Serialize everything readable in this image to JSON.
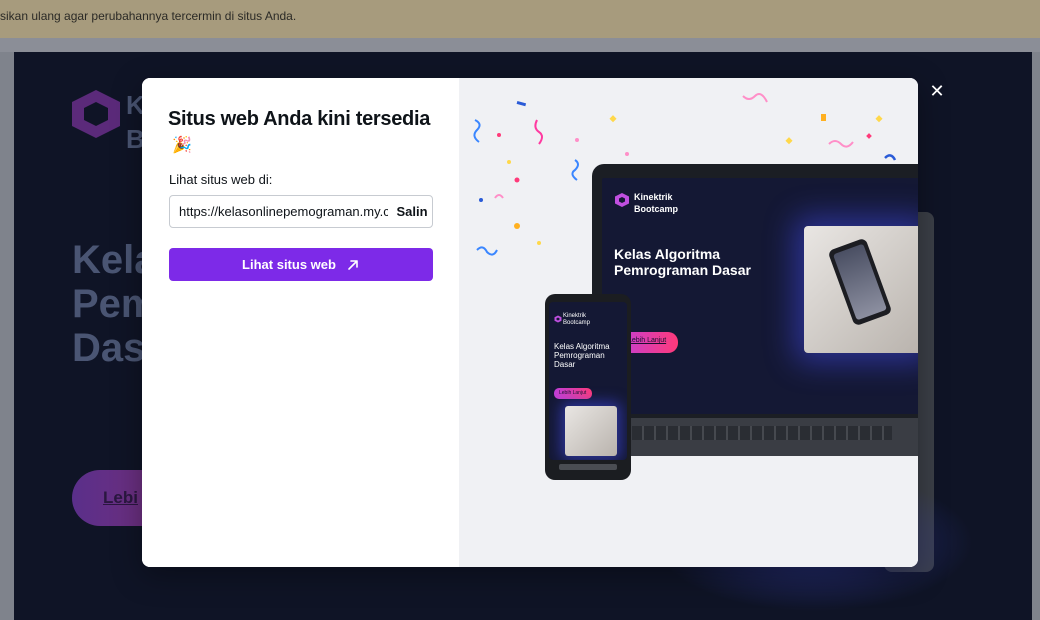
{
  "banner": {
    "text": "sikan ulang agar perubahannya tercermin di situs Anda."
  },
  "background_site": {
    "brand": "K\nB",
    "heading": "Kela\nPem\nDas",
    "cta_label": "Lebi"
  },
  "modal": {
    "title": "Situs web Anda kini tersedia",
    "title_icon": "party-popper-icon",
    "url_label": "Lihat situs web di:",
    "url_value": "https://kelasonlinepemograman.my.canva.site",
    "copy_label": "Salin",
    "view_button_label": "Lihat situs web",
    "view_button_icon": "arrow-up-right-icon",
    "close_icon": "close-icon",
    "accent_color": "#7d2ae8"
  },
  "illustration": {
    "laptop": {
      "brand": "Kinektrik\nBootcamp",
      "heading": "Kelas Algoritma Pemrograman Dasar",
      "cta_label": "Lebih Lanjut"
    },
    "phone": {
      "brand": "Kinektrik\nBootcamp",
      "heading": "Kelas Algoritma Pemrograman Dasar",
      "cta_label": "Lebih Lanjut"
    }
  }
}
